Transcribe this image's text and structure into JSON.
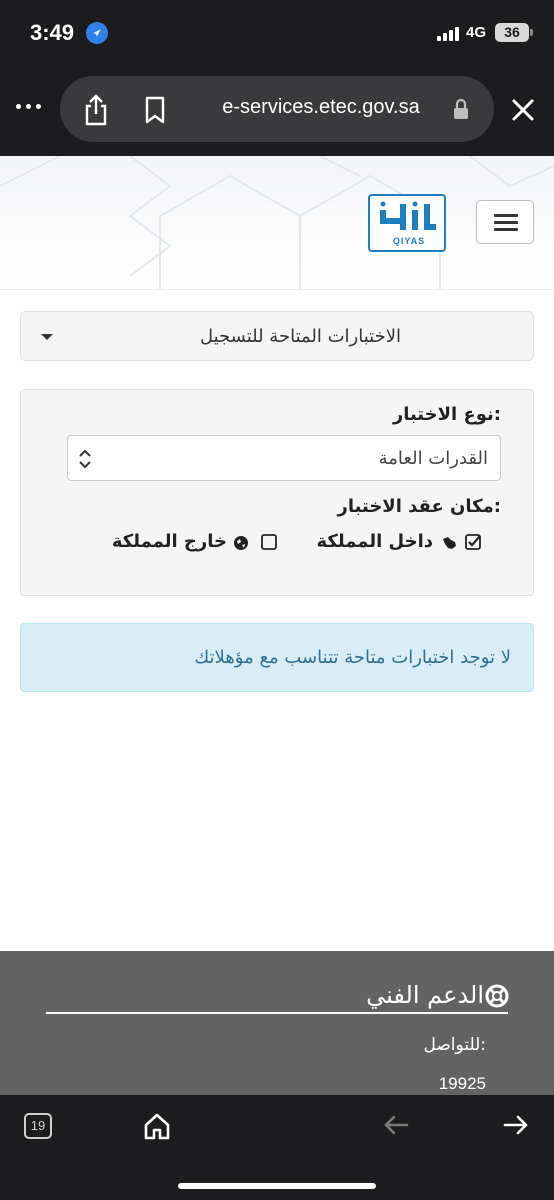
{
  "status_bar": {
    "time": "3:49",
    "network": "4G",
    "battery": "36"
  },
  "browser": {
    "url": "e-services.etec.gov.sa",
    "tabs_count": "19"
  },
  "header": {
    "logo_text": "QIYAS"
  },
  "tests": {
    "dropdown_label": "الاختبارات المتاحة للتسجيل"
  },
  "filter": {
    "type_label": "نوع الاختبار:",
    "type_value": "القدرات العامة",
    "place_label": "مكان عقد الاختبار:",
    "inside_label": "داخل المملكة",
    "inside_checked": true,
    "outside_label": "خارج المملكة",
    "outside_checked": false
  },
  "alert": {
    "message": "لا توجد اختبارات متاحة تتناسب مع مؤهلاتك"
  },
  "support": {
    "title": "الدعم الفني",
    "contact_label": "للتواصل:",
    "phone": "19925"
  },
  "colors": {
    "alert_bg": "#d9edf7",
    "alert_text": "#31708f",
    "footer_bg": "#636363",
    "logo_blue": "#1e7fc0"
  }
}
